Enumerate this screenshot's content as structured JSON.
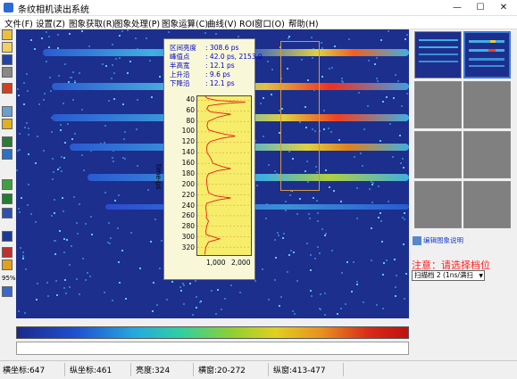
{
  "window": {
    "title": "条纹相机读出系统",
    "controls": [
      "—",
      "☐",
      "✕"
    ]
  },
  "menu": [
    "文件(F)",
    "设置(Z)",
    "图象获取(R)",
    "图象处理(P)",
    "图象运算(C)",
    "曲线(V)",
    "ROI窗口(O)",
    "帮助(H)"
  ],
  "toolbar": [
    "folder-icon",
    "open-icon",
    "save-icon",
    "print-icon",
    "run-icon",
    "image-icon",
    "tool-icon",
    "stack-icon",
    "table-icon",
    "grid-icon",
    "chart-icon",
    "film-icon",
    "disc-icon",
    "bars-icon",
    "zoom-icon",
    "undo-icon"
  ],
  "toolbar_labels": {
    "zoom": "95%"
  },
  "panel": {
    "rows": [
      {
        "label": "区间亮度",
        "value": "308.6 ps"
      },
      {
        "label": "峰值点",
        "value": "42.0 ps, 2153.0"
      },
      {
        "label": "半高宽",
        "value": "12.1 ps"
      },
      {
        "label": "上升沿",
        "value": "9.6 ps"
      },
      {
        "label": "下降沿",
        "value": "12.1 ps"
      }
    ],
    "yticks": [
      "40",
      "60",
      "80",
      "100",
      "120",
      "140",
      "160",
      "180",
      "200",
      "220",
      "240",
      "260",
      "280",
      "300",
      "320"
    ],
    "ylabel": "time-ps",
    "xticks": [
      "1,000",
      "2,000"
    ]
  },
  "chart_data": {
    "type": "line",
    "title": "",
    "xlabel": "",
    "ylabel": "time-ps",
    "ylim": [
      32,
      335
    ],
    "xlim": [
      0,
      2400
    ],
    "series": [
      {
        "name": "",
        "y": [
          32,
          36,
          40,
          43,
          46,
          50,
          56,
          62,
          66,
          72,
          80,
          88,
          96,
          100,
          104,
          108,
          112,
          118,
          124,
          130,
          140,
          150,
          160,
          166,
          170,
          174,
          180,
          186,
          194,
          204,
          216,
          222,
          226,
          230,
          236,
          244,
          252,
          258,
          264,
          270,
          280,
          290,
          296,
          300,
          304,
          310,
          320,
          328,
          334
        ],
        "x": [
          350,
          450,
          900,
          2150,
          1200,
          500,
          420,
          600,
          1500,
          900,
          480,
          430,
          500,
          800,
          1200,
          1700,
          1100,
          600,
          450,
          420,
          440,
          600,
          700,
          1100,
          1500,
          900,
          500,
          430,
          420,
          440,
          500,
          800,
          1500,
          900,
          420,
          380,
          400,
          420,
          400,
          500,
          420,
          380,
          400,
          700,
          1000,
          500,
          380,
          350,
          340
        ]
      }
    ],
    "colors": {
      "line": "#e0201a",
      "plot_bg": "#f6ee6a",
      "grid": "#f09a55"
    }
  },
  "colors": {
    "accent": "#3b78d8",
    "warning": "#ff2020",
    "roi": "#d49a40",
    "image_bg": "#1c2f8c"
  },
  "right": {
    "link_label": "编辑图象说明",
    "warning": "注意：请选择档位",
    "select_value": "扫描档 2 (1ns/满扫",
    "thumbnails": 8
  },
  "status": {
    "x": "横坐标:647",
    "y": "纵坐标:461",
    "brightness": "亮度:324",
    "h_range": "横窗:20-272",
    "v_range": "纵窗:413-477"
  }
}
